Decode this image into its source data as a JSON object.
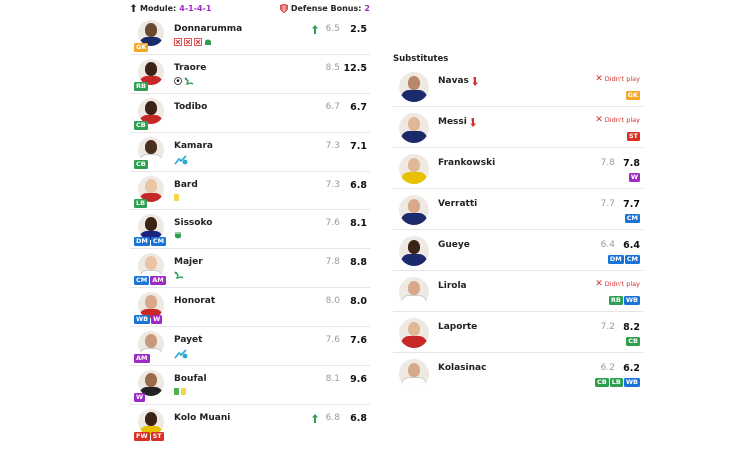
{
  "header": {
    "module_label": "Module:",
    "module_value": "4-1-4-1",
    "defense_label": "Defense Bonus:",
    "defense_value": "2"
  },
  "colors": {
    "GK": "#f5a623",
    "CB": "#2e9e4f",
    "RB": "#2e9e4f",
    "LB": "#2e9e4f",
    "WB": "#1a73d6",
    "DM": "#1a73d6",
    "CM": "#1a73d6",
    "AM": "#9c2bc5",
    "W": "#9c2bc5",
    "FW": "#d93025",
    "ST": "#d93025",
    "accent": "#a127c7"
  },
  "starters": [
    {
      "name": "Donnarumma",
      "roles": [
        "GK"
      ],
      "vote": "6.5",
      "fvote": "2.5",
      "trend": "up",
      "badges": [
        "conceded-goal-icon",
        "conceded-goal-icon",
        "conceded-goal-icon",
        "save-icon"
      ],
      "shirt": "#1b2a6b",
      "skin": "#6b4a32"
    },
    {
      "name": "Traore",
      "roles": [
        "RB"
      ],
      "vote": "8.5",
      "fvote": "12.5",
      "trend": "",
      "badges": [
        "goal-icon",
        "assist-icon"
      ],
      "shirt": "#c62828",
      "skin": "#3b2416"
    },
    {
      "name": "Todibo",
      "roles": [
        "CB"
      ],
      "vote": "6.7",
      "fvote": "6.7",
      "trend": "",
      "badges": [],
      "shirt": "#c62828",
      "skin": "#3b2416"
    },
    {
      "name": "Kamara",
      "roles": [
        "CB"
      ],
      "vote": "7.3",
      "fvote": "7.1",
      "trend": "",
      "badges": [
        "sub-out-icon"
      ],
      "shirt": "#ffffff",
      "skin": "#4a2e1e"
    },
    {
      "name": "Bard",
      "roles": [
        "LB"
      ],
      "vote": "7.3",
      "fvote": "6.8",
      "trend": "",
      "badges": [
        "yellow-card-icon"
      ],
      "shirt": "#c62828",
      "skin": "#e9c5a6"
    },
    {
      "name": "Sissoko",
      "roles": [
        "DM",
        "CM"
      ],
      "vote": "7.6",
      "fvote": "8.1",
      "trend": "",
      "badges": [
        "clean-sheet-icon"
      ],
      "shirt": "#1a237e",
      "skin": "#3b2416"
    },
    {
      "name": "Majer",
      "roles": [
        "CM",
        "AM"
      ],
      "vote": "7.8",
      "fvote": "8.8",
      "trend": "",
      "badges": [
        "assist-icon"
      ],
      "shirt": "#ffffff",
      "skin": "#e9c5a6"
    },
    {
      "name": "Honorat",
      "roles": [
        "WB",
        "W"
      ],
      "vote": "8.0",
      "fvote": "8.0",
      "trend": "",
      "badges": [],
      "shirt": "#c62828",
      "skin": "#d7a98a"
    },
    {
      "name": "Payet",
      "roles": [
        "AM"
      ],
      "vote": "7.6",
      "fvote": "7.6",
      "trend": "",
      "badges": [
        "sub-out-icon"
      ],
      "shirt": "#ffffff",
      "skin": "#c79a7a"
    },
    {
      "name": "Boufal",
      "roles": [
        "W"
      ],
      "vote": "8.1",
      "fvote": "9.6",
      "trend": "",
      "badges": [
        "green-card-icon",
        "yellow-card-icon"
      ],
      "shirt": "#222222",
      "skin": "#9a6a4a"
    },
    {
      "name": "Kolo Muani",
      "roles": [
        "FW",
        "ST"
      ],
      "vote": "6.8",
      "fvote": "6.8",
      "trend": "up",
      "badges": [],
      "shirt": "#e8c000",
      "skin": "#3b2416"
    }
  ],
  "subs_title": "Substitutes",
  "dnp_text": "Didn't play",
  "substitutes": [
    {
      "name": "Navas",
      "subout": true,
      "dnp": true,
      "vote": "",
      "fvote": "",
      "roles": [
        "GK"
      ],
      "shirt": "#1b2a6b",
      "skin": "#b78866"
    },
    {
      "name": "Messi",
      "subout": true,
      "dnp": true,
      "vote": "",
      "fvote": "",
      "roles": [
        "ST"
      ],
      "shirt": "#1b2a6b",
      "skin": "#e0b896"
    },
    {
      "name": "Frankowski",
      "subout": false,
      "dnp": false,
      "vote": "7.8",
      "fvote": "7.8",
      "roles": [
        "W"
      ],
      "shirt": "#e8c000",
      "skin": "#e0b896"
    },
    {
      "name": "Verratti",
      "subout": false,
      "dnp": false,
      "vote": "7.7",
      "fvote": "7.7",
      "roles": [
        "CM"
      ],
      "shirt": "#1b2a6b",
      "skin": "#d7a98a"
    },
    {
      "name": "Gueye",
      "subout": false,
      "dnp": false,
      "vote": "6.4",
      "fvote": "6.4",
      "roles": [
        "DM",
        "CM"
      ],
      "shirt": "#1b2a6b",
      "skin": "#3b2416"
    },
    {
      "name": "Lirola",
      "subout": false,
      "dnp": true,
      "vote": "",
      "fvote": "",
      "roles": [
        "RB",
        "WB"
      ],
      "shirt": "#ffffff",
      "skin": "#d7a98a"
    },
    {
      "name": "Laporte",
      "subout": false,
      "dnp": false,
      "vote": "7.2",
      "fvote": "8.2",
      "roles": [
        "CB"
      ],
      "shirt": "#c62828",
      "skin": "#e0b896"
    },
    {
      "name": "Kolasinac",
      "subout": false,
      "dnp": false,
      "vote": "6.2",
      "fvote": "6.2",
      "roles": [
        "CB",
        "LB",
        "WB"
      ],
      "shirt": "#ffffff",
      "skin": "#d7a98a"
    }
  ]
}
